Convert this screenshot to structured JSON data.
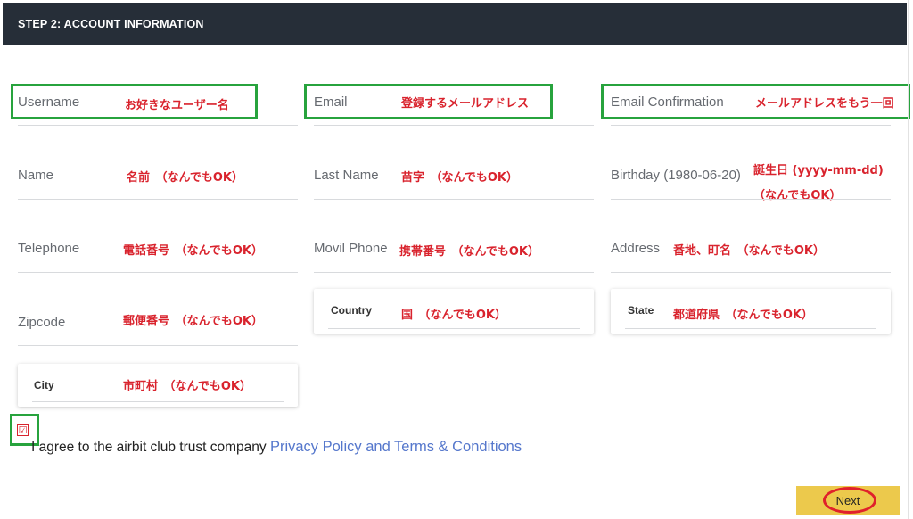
{
  "header": {
    "title": "STEP 2: ACCOUNT INFORMATION"
  },
  "fields": {
    "username": {
      "label": "Username",
      "note": "お好きなユーザー名"
    },
    "email": {
      "label": "Email",
      "note": "登録するメールアドレス"
    },
    "email_confirmation": {
      "label": "Email Confirmation",
      "note": "メールアドレスをもう一回"
    },
    "name": {
      "label": "Name",
      "note": "名前　（なんでもOK）"
    },
    "last_name": {
      "label": "Last Name",
      "note": "苗字　（なんでもOK）"
    },
    "birthday": {
      "label": "Birthday (1980-06-20)",
      "note_line1": "誕生日 (yyyy-mm-dd)",
      "note_line2": "（なんでもOK）"
    },
    "telephone": {
      "label": "Telephone",
      "note": "電話番号　（なんでもOK）"
    },
    "movil_phone": {
      "label": "Movil Phone",
      "note": "携帯番号　（なんでもOK）"
    },
    "address": {
      "label": "Address",
      "note": "番地、町名　（なんでもOK）"
    },
    "zipcode": {
      "label": "Zipcode",
      "note": "郵便番号　（なんでもOK）"
    },
    "country": {
      "label": "Country",
      "note": "国　（なんでもOK）"
    },
    "state": {
      "label": "State",
      "note": "都道府県　（なんでもOK）"
    },
    "city": {
      "label": "City",
      "note": "市町村　（なんでもOK）"
    }
  },
  "agreement": {
    "checkbox_mark": "☑",
    "text": "I agree to the airbit club trust company ",
    "link": "Privacy Policy and Terms & Conditions"
  },
  "next_button": {
    "label": "Next"
  },
  "colors": {
    "header": "#262e38",
    "annotation_red": "#d9232d",
    "highlight_green": "#27a33d",
    "button": "#ecc94c",
    "link": "#5577cc"
  }
}
